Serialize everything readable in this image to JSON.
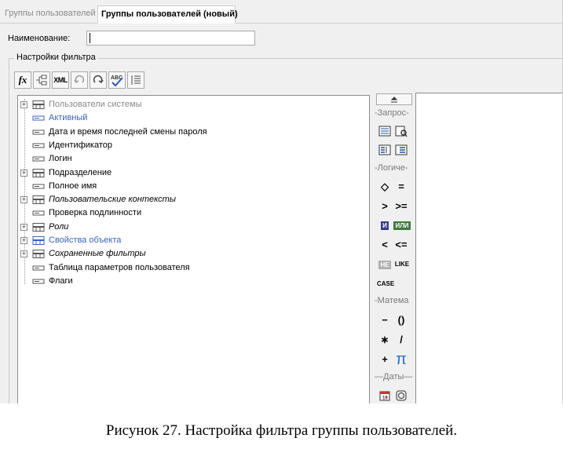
{
  "tabs": [
    {
      "label": "Группы пользователей",
      "active": false
    },
    {
      "label": "Группы пользователей (новый)",
      "active": true
    }
  ],
  "form": {
    "name_label": "Наименование:",
    "name_value": ""
  },
  "filter": {
    "group_title": "Настройки фильтра",
    "toolbar": [
      {
        "icon": "fx-icon",
        "label": "fx"
      },
      {
        "icon": "field-add-icon",
        "label": ""
      },
      {
        "icon": "xml-icon",
        "label": "XML"
      },
      {
        "icon": "undo-icon",
        "label": ""
      },
      {
        "icon": "redo-icon",
        "label": ""
      },
      {
        "icon": "check-syntax-icon",
        "label": ""
      },
      {
        "icon": "list-icon",
        "label": ""
      }
    ],
    "tree": [
      {
        "label": "Пользователи системы",
        "expandable": true,
        "style": "dim",
        "icon": "table-icon"
      },
      {
        "label": "Активный",
        "expandable": false,
        "style": "blue",
        "icon": "field-icon"
      },
      {
        "label": "Дата и время последней смены пароля",
        "expandable": false,
        "style": "normal",
        "icon": "field-icon"
      },
      {
        "label": "Идентификатор",
        "expandable": false,
        "style": "normal",
        "icon": "field-icon"
      },
      {
        "label": "Логин",
        "expandable": false,
        "style": "normal",
        "icon": "field-icon"
      },
      {
        "label": "Подразделение",
        "expandable": true,
        "style": "normal",
        "icon": "table-icon"
      },
      {
        "label": "Полное имя",
        "expandable": false,
        "style": "normal",
        "icon": "field-icon"
      },
      {
        "label": "Пользовательские контексты",
        "expandable": true,
        "style": "italic",
        "icon": "table-icon"
      },
      {
        "label": "Проверка подлинности",
        "expandable": false,
        "style": "normal",
        "icon": "field-icon"
      },
      {
        "label": "Роли",
        "expandable": true,
        "style": "italic",
        "icon": "table-icon"
      },
      {
        "label": "Свойства объекта",
        "expandable": true,
        "style": "blue",
        "icon": "table-icon"
      },
      {
        "label": "Сохраненные фильтры",
        "expandable": true,
        "style": "italic",
        "icon": "table-icon"
      },
      {
        "label": "Таблица параметров пользователя",
        "expandable": false,
        "style": "normal",
        "icon": "field-icon"
      },
      {
        "label": "Флаги",
        "expandable": false,
        "style": "normal",
        "icon": "field-icon"
      }
    ]
  },
  "palette": {
    "headers": [
      "-Запрос-",
      "-Логиче-",
      "-Матема",
      "—Даты—"
    ],
    "ops": {
      "ne": "◇",
      "eq": "=",
      "gt": ">",
      "ge": ">=",
      "and": "И",
      "or": "ИЛИ",
      "lt": "<",
      "le": "<=",
      "not": "НЕ",
      "like": "LIKE",
      "case": "CASE",
      "minus": "−",
      "parens": "()",
      "mul": "∗",
      "div": "/",
      "plus": "+",
      "pi": "π"
    }
  },
  "caption": "Рисунок 27. Настройка фильтра группы пользователей.",
  "colors": {
    "blue_text": "#3a62c4",
    "and_badge": "#3b3b8f",
    "or_badge": "#3f7a3f",
    "not_badge": "#b0b0b0"
  }
}
